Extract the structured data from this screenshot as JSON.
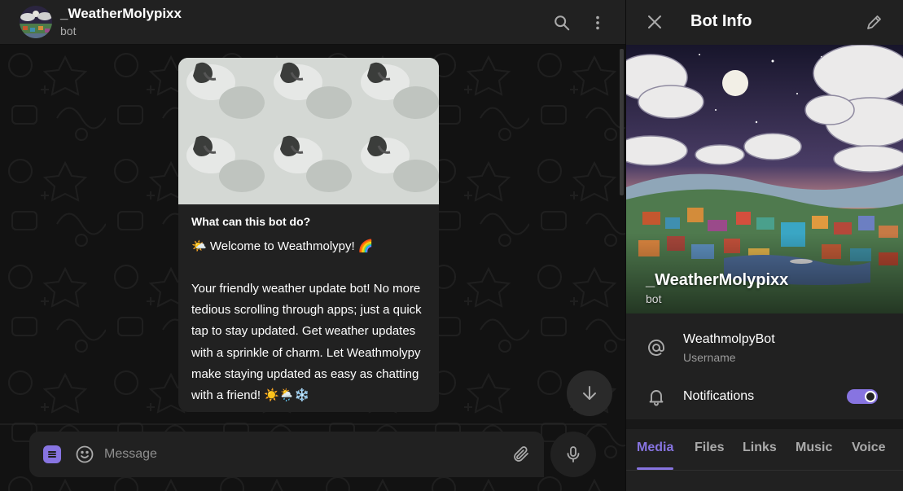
{
  "chat": {
    "title": "_WeatherMolypixx",
    "subtitle": "bot",
    "search_icon": "search-icon",
    "more_icon": "more-vertical-icon"
  },
  "message": {
    "heading": "What can this bot do?",
    "welcome": "🌤️ Welcome to Weathmolypy! 🌈",
    "body": "Your friendly weather update bot! No more tedious scrolling through apps; just a quick tap to stay updated. Get weather updates with a sprinkle of charm. Let Weathmolypy make staying updated as easy as chatting with a friend! ☀️🌦️❄️"
  },
  "composer": {
    "placeholder": "Message"
  },
  "panel": {
    "title": "Bot Info",
    "name": "_WeatherMolypixx",
    "subtitle": "bot",
    "username": "WeathmolpyBot",
    "username_label": "Username",
    "notifications_label": "Notifications",
    "notifications_on": true,
    "tabs": [
      {
        "label": "Media",
        "active": true
      },
      {
        "label": "Files",
        "active": false
      },
      {
        "label": "Links",
        "active": false
      },
      {
        "label": "Music",
        "active": false
      },
      {
        "label": "Voice",
        "active": false
      }
    ]
  },
  "colors": {
    "accent": "#8774e1",
    "surface": "#212121",
    "background": "#121212"
  }
}
